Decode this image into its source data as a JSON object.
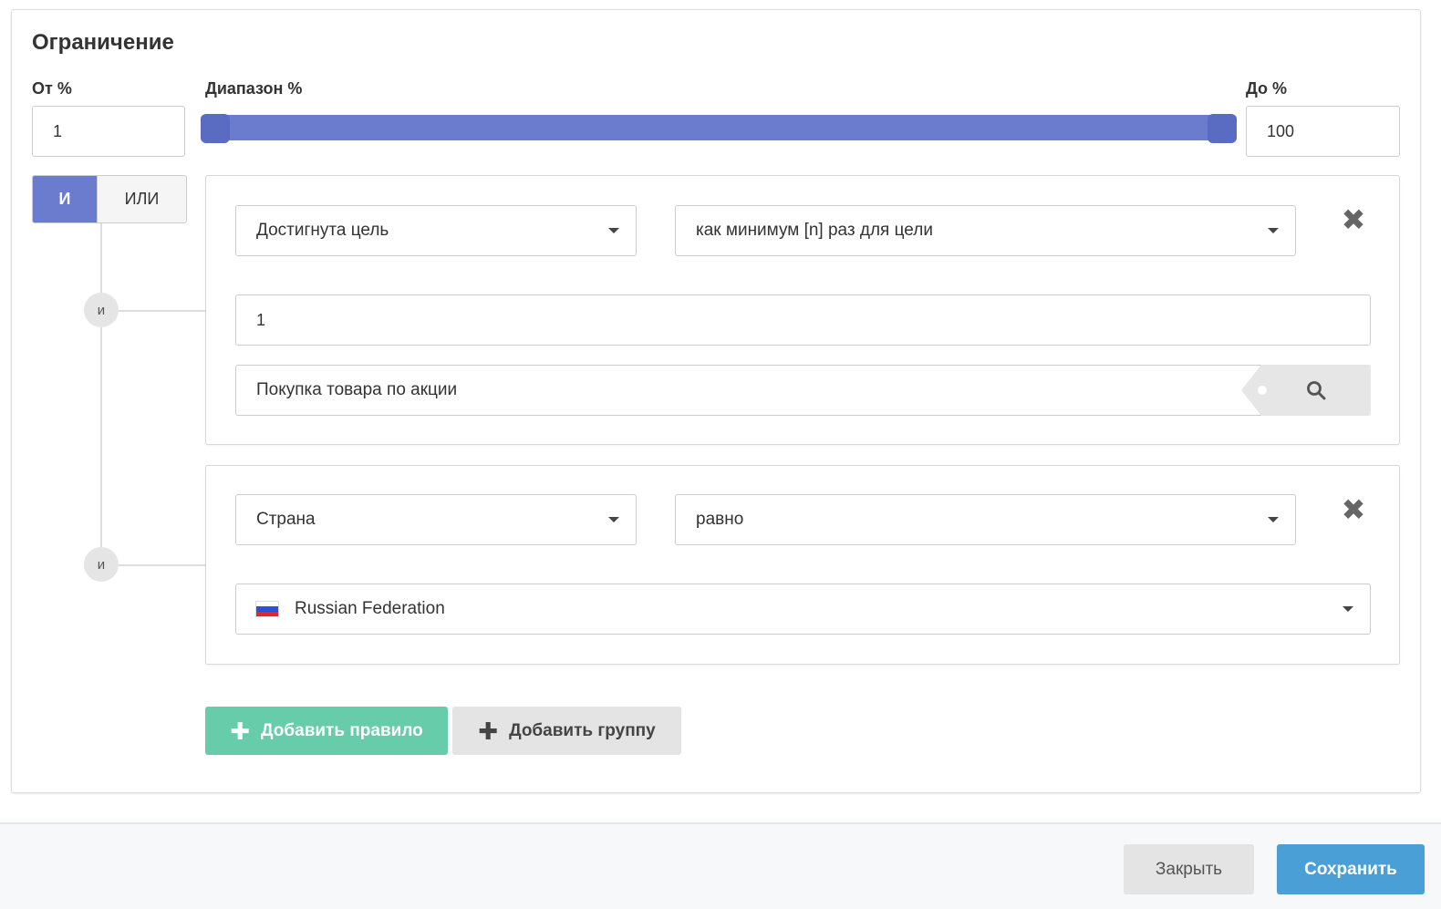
{
  "section": {
    "title": "Ограничение"
  },
  "range": {
    "from_label": "От %",
    "from_value": "1",
    "range_label": "Диапазон %",
    "to_label": "До %",
    "to_value": "100",
    "slider_min": 1,
    "slider_max": 100
  },
  "logic_toggle": {
    "and_label": "И",
    "or_label": "ИЛИ",
    "selected": "И"
  },
  "connectors": [
    {
      "label": "и"
    },
    {
      "label": "и"
    }
  ],
  "rules": [
    {
      "field": "Достигнута цель",
      "operator": "как минимум [n] раз для цели",
      "count_value": "1",
      "goal_value": "Покупка товара по акции",
      "remove_icon": "close-icon",
      "search_icon": "search-icon"
    },
    {
      "field": "Страна",
      "operator": "равно",
      "country_value": "Russian Federation",
      "country_flag": "russia-flag-icon",
      "remove_icon": "close-icon"
    }
  ],
  "actions": {
    "add_rule_label": "Добавить правило",
    "add_group_label": "Добавить группу"
  },
  "footer": {
    "close_label": "Закрыть",
    "save_label": "Сохранить"
  },
  "colors": {
    "accent": "#6b7cce",
    "add_rule": "#66ccaa",
    "save": "#4a9fd6"
  }
}
